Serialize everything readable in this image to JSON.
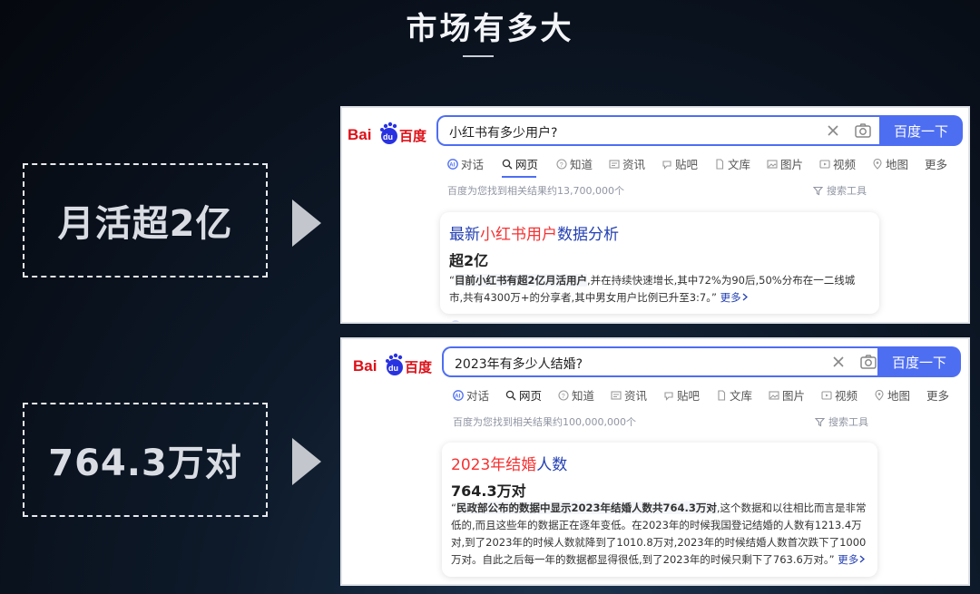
{
  "slide": {
    "title": "市场有多大"
  },
  "stats": [
    {
      "value": "月活超2亿"
    },
    {
      "value": "764.3万对"
    }
  ],
  "panels": [
    {
      "logo": {
        "bai": "Bai",
        "du": "du",
        "cn": "百度"
      },
      "query": "小红书有多少用户?",
      "button": "百度一下",
      "tabs": [
        "对话",
        "网页",
        "知道",
        "资讯",
        "贴吧",
        "文库",
        "图片",
        "视频",
        "地图",
        "更多"
      ],
      "active_tab": "网页",
      "result_count": "百度为您找到相关结果约13,700,000个",
      "tools": "搜索工具",
      "card": {
        "title_pre": "最新",
        "title_hl": "小红书用户",
        "title_post": "数据分析",
        "answer": "超2亿",
        "desc_open": "“",
        "desc_bold": "目前小红书有超2亿月活用户",
        "desc_rest": ",并在持续快速增长,其中72%为90后,50%分布在一二线城市,共有4300万+的分享者,其中男女用户比例已升至3:7。”",
        "more": "更多"
      }
    },
    {
      "logo": {
        "bai": "Bai",
        "du": "du",
        "cn": "百度"
      },
      "query": "2023年有多少人结婚?",
      "button": "百度一下",
      "tabs": [
        "对话",
        "网页",
        "知道",
        "资讯",
        "贴吧",
        "文库",
        "图片",
        "视频",
        "地图",
        "更多"
      ],
      "active_tab": "网页",
      "result_count": "百度为您找到相关结果约100,000,000个",
      "tools": "搜索工具",
      "card": {
        "title_pre": "",
        "title_hl": "2023年结婚",
        "title_post": "人数",
        "answer": "764.3万对",
        "desc_open": "“",
        "desc_bold": "民政部公布的数据中显示2023年结婚人数共764.3万对",
        "desc_rest": ",这个数据和以往相比而言是非常低的,而且这些年的数据正在逐年变低。在2023年的时候我国登记结婚的人数有1213.4万对,到了2023年的时候人数就降到了1010.8万对,2023年的时候结婚人数首次跌下了1000万对。自此之后每一年的数据都显得很低,到了2023年的时候只剩下了763.6万对。”",
        "more": "更多"
      }
    }
  ],
  "colors": {
    "brand_blue": "#4e6ef2",
    "logo_red": "#de0f17",
    "logo_blue": "#2932e1",
    "highlight_red": "#f73131",
    "link_blue": "#2440b3"
  },
  "icons": [
    "ai-chat-icon",
    "search-icon",
    "question-icon",
    "news-icon",
    "tieba-icon",
    "doc-icon",
    "image-icon",
    "video-icon",
    "map-icon",
    "close-icon",
    "camera-icon",
    "filter-icon",
    "chevron-right-icon",
    "play-arrow-icon"
  ]
}
